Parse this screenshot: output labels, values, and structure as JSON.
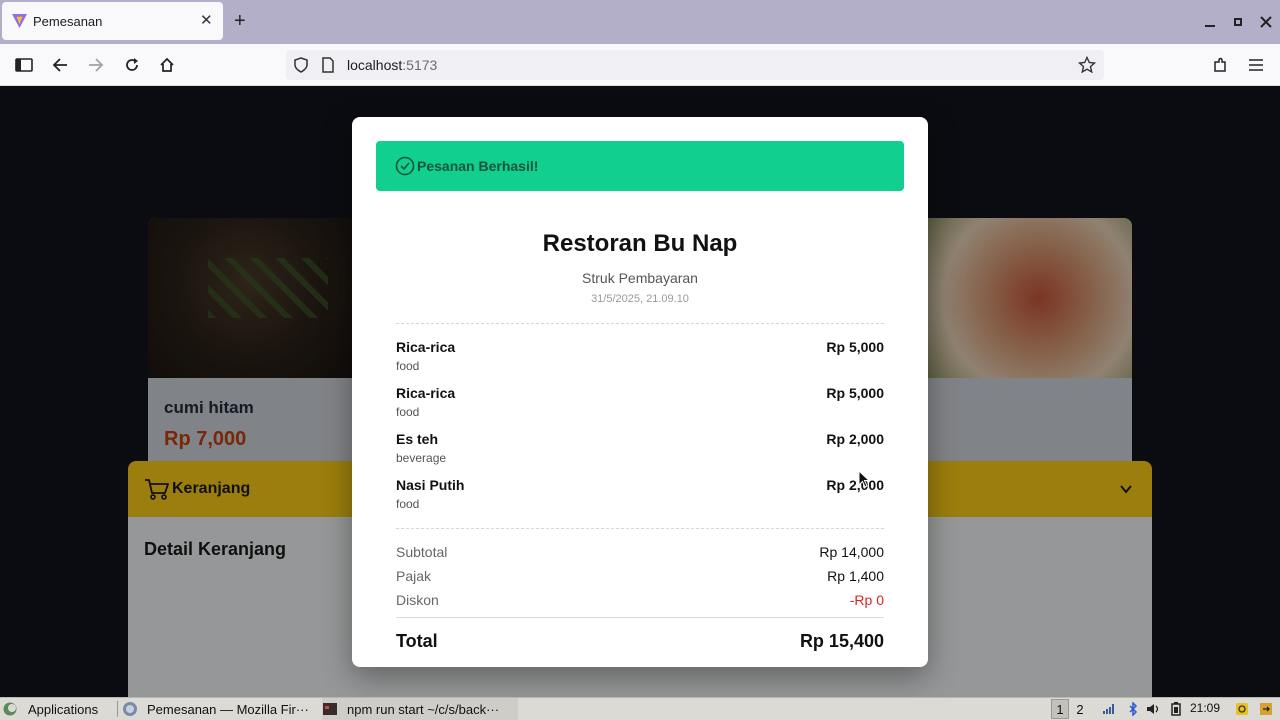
{
  "browser": {
    "tab_title": "Pemesanan",
    "url_host": "localhost",
    "url_port": ":5173"
  },
  "page": {
    "card_left": {
      "name": "cumi hitam",
      "price": "Rp 7,000"
    },
    "cart": {
      "label": "Keranjang",
      "detail_title": "Detail Keranjang"
    }
  },
  "modal": {
    "success_text": "Pesanan Berhasil!",
    "restaurant_name": "Restoran Bu Nap",
    "subtitle": "Struk Pembayaran",
    "datetime": "31/5/2025, 21.09.10",
    "items": [
      {
        "name": "Rica-rica",
        "category": "food",
        "price": "Rp 5,000"
      },
      {
        "name": "Rica-rica",
        "category": "food",
        "price": "Rp 5,000"
      },
      {
        "name": "Es teh",
        "category": "beverage",
        "price": "Rp 2,000"
      },
      {
        "name": "Nasi Putih",
        "category": "food",
        "price": "Rp 2,000"
      }
    ],
    "subtotal_label": "Subtotal",
    "subtotal_value": "Rp 14,000",
    "tax_label": "Pajak",
    "tax_value": "Rp 1,400",
    "discount_label": "Diskon",
    "discount_value": "-Rp 0",
    "total_label": "Total",
    "total_value": "Rp 15,400"
  },
  "taskbar": {
    "apps_label": "Applications",
    "task1": "Pemesanan — Mozilla Fir···",
    "task2": "npm run start ~/c/s/back···",
    "workspace1": "1",
    "workspace2": "2",
    "clock": "21:09"
  },
  "colors": {
    "success": "#10cf8f",
    "cart_bar": "#facc15",
    "price_accent": "#c2410c",
    "discount": "#dc2626"
  },
  "icons": [
    "firefox-icon",
    "close-icon",
    "plus-icon",
    "sidebar-icon",
    "back-icon",
    "forward-icon",
    "reload-icon",
    "home-icon",
    "shield-icon",
    "page-icon",
    "star-icon",
    "extensions-icon",
    "menu-icon",
    "check-circle-icon",
    "cart-icon",
    "chevron-down-icon"
  ]
}
